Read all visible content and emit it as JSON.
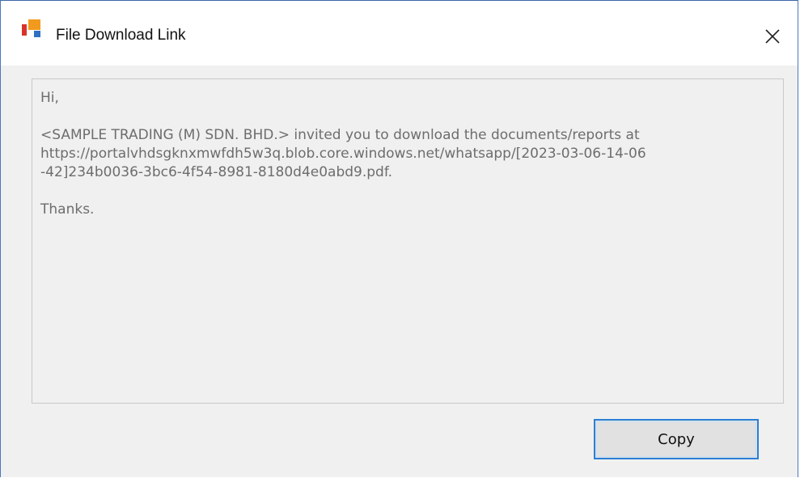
{
  "window": {
    "title": "File Download Link",
    "icon": "app-logo-icon",
    "close_icon": "close-icon"
  },
  "message": {
    "greeting": "Hi,",
    "body_lines": [
      "<SAMPLE TRADING (M) SDN. BHD.> invited you to download the documents/reports at",
      "https://portalvhdsgknxmwfdh5w3q.blob.core.windows.net/whatsapp/[2023-03-06-14-06",
      "-42]234b0036-3bc6-4f54-8981-8180d4e0abd9.pdf."
    ],
    "closing": "Thanks."
  },
  "actions": {
    "copy_label": "Copy"
  },
  "colors": {
    "window_border": "#4a78b8",
    "dialog_background": "#f0f0f0",
    "text_muted": "#6d6d6d",
    "button_focus_border": "#2a7fd4",
    "logo_red": "#d9342b",
    "logo_orange": "#f29a1d",
    "logo_blue": "#2f6fc4"
  }
}
